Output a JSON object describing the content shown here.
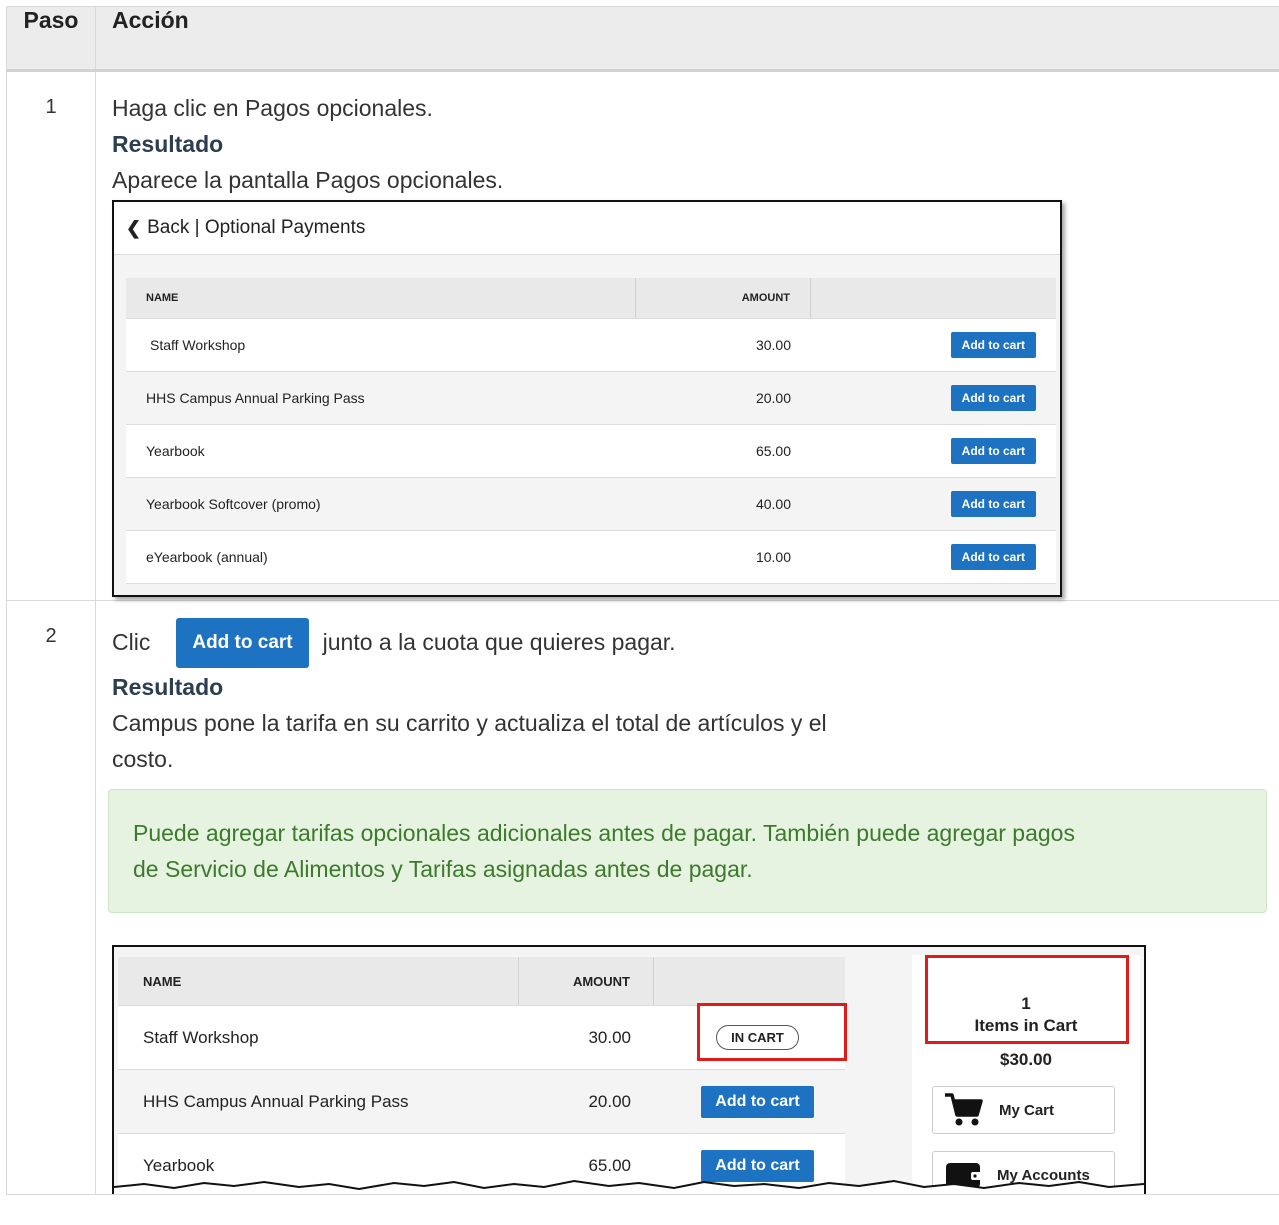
{
  "table": {
    "col_step": "Paso",
    "col_action": "Acción"
  },
  "steps": [
    {
      "number": "1",
      "instruction": "Haga clic en Pagos opcionales.",
      "result_label": "Resultado",
      "result_text": "Aparece la pantalla Pagos opcionales."
    },
    {
      "number": "2",
      "instruction_prefix": "Clic",
      "button_label": "Add to cart",
      "instruction_suffix": "junto a la cuota que quieres pagar.",
      "result_label": "Resultado",
      "result_line1": "Campus pone la tarifa en su carrito y actualiza el total de artículos y el",
      "result_line2": "costo.",
      "note_line1": "Puede agregar tarifas opcionales adicionales antes de pagar. También puede agregar pagos",
      "note_line2": "de Servicio de Alimentos y Tarifas asignadas antes de pagar."
    }
  ],
  "screenshot1": {
    "back_label": "Back | Optional Payments",
    "col_name": "NAME",
    "col_amount": "AMOUNT",
    "button_label": "Add to cart",
    "rows": [
      {
        "name": "Staff Workshop",
        "amount": "30.00"
      },
      {
        "name": "HHS Campus Annual Parking Pass",
        "amount": "20.00"
      },
      {
        "name": "Yearbook",
        "amount": "65.00"
      },
      {
        "name": "Yearbook Softcover (promo)",
        "amount": "40.00"
      },
      {
        "name": "eYearbook (annual)",
        "amount": "10.00"
      }
    ]
  },
  "screenshot2": {
    "col_name": "NAME",
    "col_amount": "AMOUNT",
    "in_cart_label": "IN CART",
    "button_label": "Add to cart",
    "rows": [
      {
        "name": "Staff Workshop",
        "amount": "30.00"
      },
      {
        "name": "HHS Campus Annual Parking Pass",
        "amount": "20.00"
      },
      {
        "name": "Yearbook",
        "amount": "65.00"
      }
    ],
    "cart_count": "1",
    "cart_label": "Items in Cart",
    "cart_total": "$30.00",
    "my_cart_label": "My Cart",
    "my_accounts_label": "My Accounts",
    "highlight_color": "#e01b1b"
  },
  "colors": {
    "button_blue": "#1d72c2",
    "note_bg": "#e5f3e0",
    "note_text": "#3c7a2c"
  }
}
